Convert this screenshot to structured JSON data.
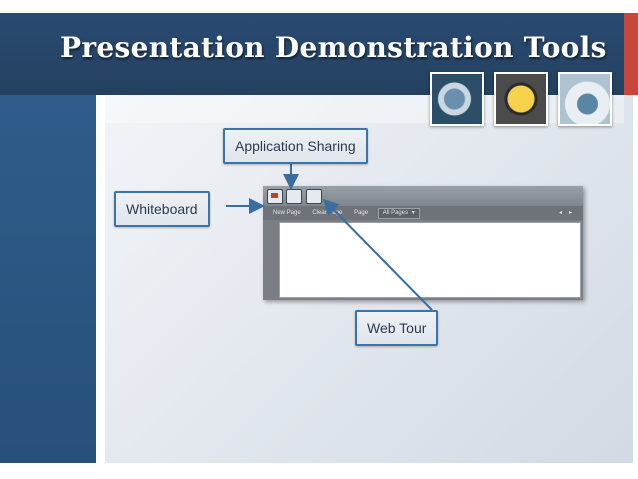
{
  "slide": {
    "title": "Presentation Demonstration Tools"
  },
  "callouts": {
    "application_sharing": "Application Sharing",
    "whiteboard": "Whiteboard",
    "web_tour": "Web Tour"
  },
  "window": {
    "strip": {
      "new_page": "New Page",
      "clear_page": "Clear Page",
      "page_label": "Page",
      "page_select": "All Pages",
      "select_arrow": "▾",
      "controls": [
        "◂",
        "▸"
      ]
    }
  },
  "colors": {
    "header": "#2a4a73",
    "sidebar": "#2f5c8a",
    "accent": "#c8473b",
    "callout_border": "#3b74a8",
    "arrow": "#3a6ea0"
  },
  "icons": [
    "camera-lens-icon",
    "headphones-icon",
    "dvd-drive-icon",
    "whiteboard-tool-icon",
    "app-sharing-tool-icon",
    "web-tour-tool-icon"
  ]
}
